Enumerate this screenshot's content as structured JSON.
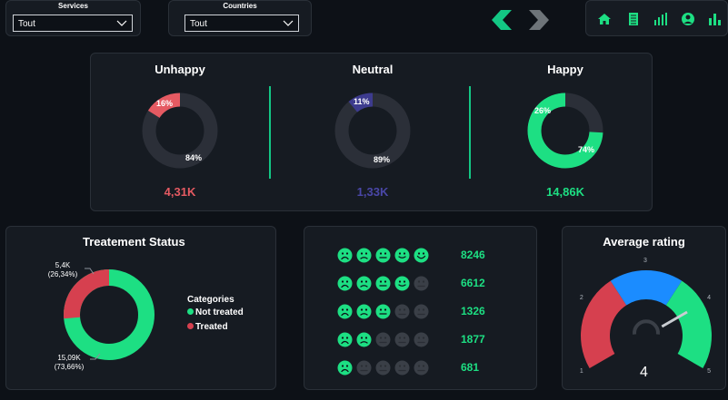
{
  "filters": {
    "services": {
      "label": "Services",
      "value": "Tout"
    },
    "countries": {
      "label": "Countries",
      "value": "Tout"
    }
  },
  "nav": {
    "back_icon": "chevron-left-icon",
    "forward_icon": "chevron-right-icon"
  },
  "toolbar": {
    "icons": [
      "home-icon",
      "document-icon",
      "bar-chart-icon",
      "user-icon",
      "bar-chart-alt-icon"
    ],
    "accent": "#1ddf83"
  },
  "sentiment": [
    {
      "title": "Unhappy",
      "pct": "16%",
      "rest_pct": "84%",
      "fraction": 0.16,
      "value": "4,31K",
      "color": "#e55a62"
    },
    {
      "title": "Neutral",
      "pct": "11%",
      "rest_pct": "89%",
      "fraction": 0.11,
      "value": "1,33K",
      "color": "#3d3b8e"
    },
    {
      "title": "Happy",
      "pct": "74%",
      "rest_pct": "26%",
      "fraction": 0.74,
      "value": "14,86K",
      "color": "#1ddf83"
    }
  ],
  "treatment": {
    "title": "Treatement Status",
    "legend_title": "Categories",
    "not_treated": {
      "label": "Not treated",
      "value": "15,09K",
      "pct": "(73,66%)",
      "fraction": 0.7366,
      "color": "#1ddf83"
    },
    "treated": {
      "label": "Treated",
      "value": "5,4K",
      "pct": "(26,34%)",
      "fraction": 0.2634,
      "color": "#d6404f"
    }
  },
  "ratings": [
    {
      "stars": 5,
      "count": "8246"
    },
    {
      "stars": 4,
      "count": "6612"
    },
    {
      "stars": 3,
      "count": "1326"
    },
    {
      "stars": 2,
      "count": "1877"
    },
    {
      "stars": 1,
      "count": "681"
    }
  ],
  "gauge": {
    "title": "Average rating",
    "value": "4",
    "value_num": 4,
    "min": 1,
    "max": 5,
    "ticks": [
      "1",
      "2",
      "3",
      "4",
      "5"
    ],
    "colors": [
      "#d6404f",
      "#1b8cff",
      "#1ddf83"
    ]
  }
}
